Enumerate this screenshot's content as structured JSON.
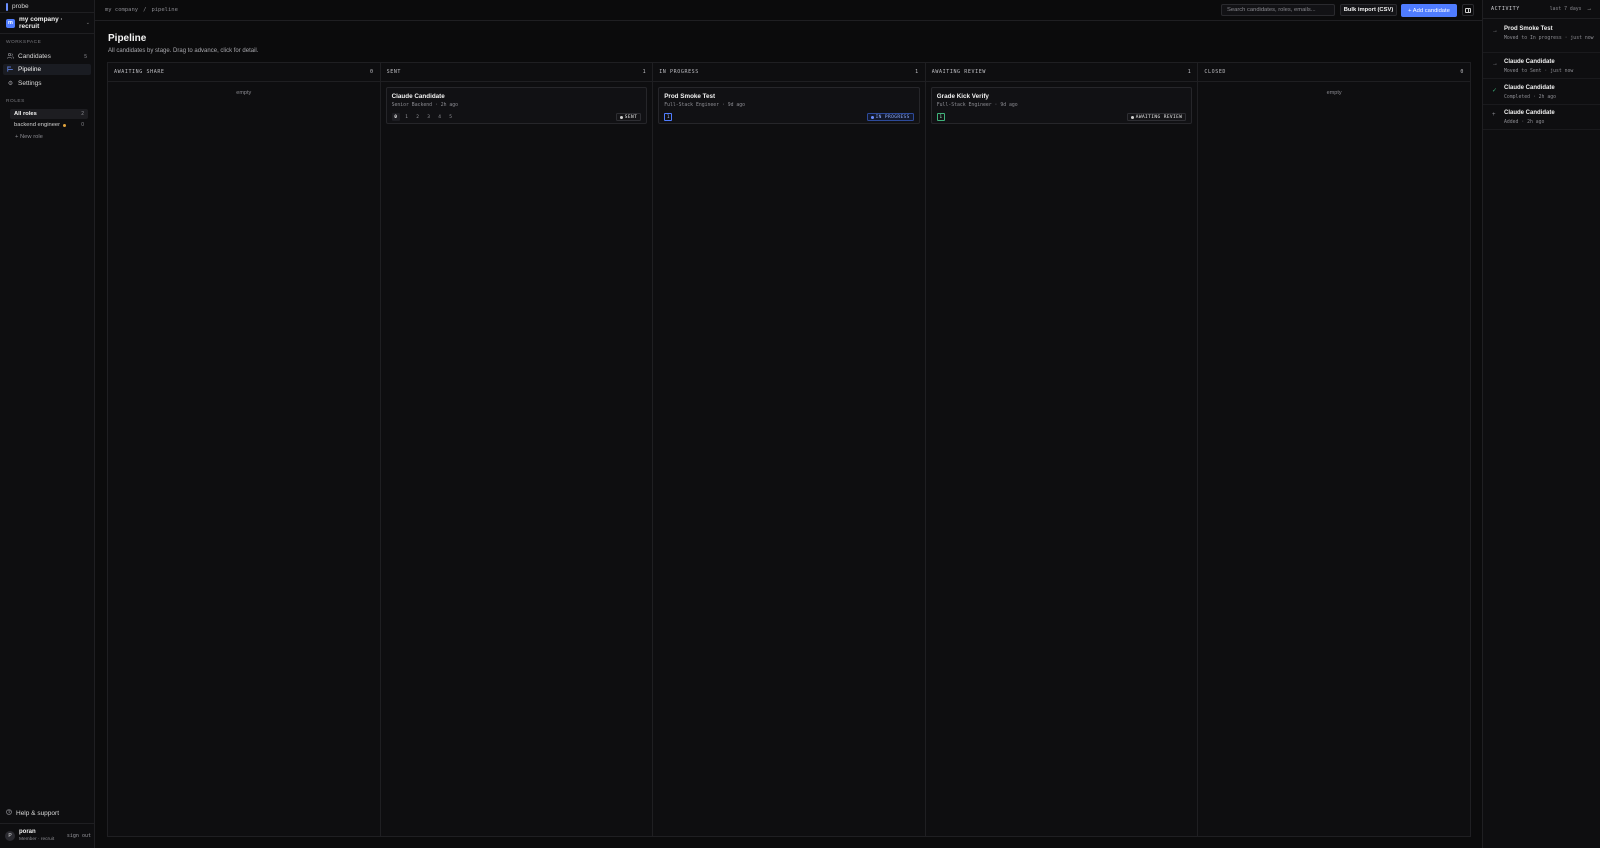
{
  "brand": {
    "name": "probe"
  },
  "workspace": {
    "avatar": "m",
    "name": "my company · recruit"
  },
  "nav": {
    "section_label": "WORKSPACE",
    "items": [
      {
        "label": "Candidates",
        "count": "5",
        "icon": "users-icon"
      },
      {
        "label": "Pipeline",
        "count": "",
        "icon": "pipeline-icon"
      },
      {
        "label": "Settings",
        "count": "",
        "icon": "gear-icon"
      }
    ]
  },
  "roles": {
    "section_label": "ROLES",
    "items": [
      {
        "label": "All roles",
        "count": "2"
      },
      {
        "label": "backend engineer",
        "count": "0"
      }
    ],
    "new_role": "+ New role"
  },
  "help": {
    "label": "Help & support"
  },
  "user": {
    "avatar": "P",
    "name": "poran",
    "role": "Member · recruit",
    "signout": "sign out"
  },
  "topbar": {
    "breadcrumb": [
      "my company",
      "/",
      "pipeline"
    ],
    "search_placeholder": "Search candidates, roles, emails...",
    "bulk_label": "Bulk import (CSV)",
    "add_label": "+ Add candidate"
  },
  "page": {
    "title": "Pipeline",
    "subtitle": "All candidates by stage. Drag to advance, click for detail."
  },
  "columns": [
    {
      "label": "AWAITING SHARE",
      "count": "0",
      "empty": "empty"
    },
    {
      "label": "SENT",
      "count": "1",
      "card": {
        "name": "Claude Candidate",
        "meta": "Senior Backend · 2h ago",
        "steps": [
          "0",
          "1",
          "2",
          "3",
          "4",
          "5"
        ],
        "badge": "SENT"
      }
    },
    {
      "label": "IN PROGRESS",
      "count": "1",
      "card": {
        "name": "Prod Smoke Test",
        "meta": "Full-Stack Engineer · 9d ago",
        "steps": [
          "1"
        ],
        "badge": "IN PROGRESS"
      }
    },
    {
      "label": "AWAITING REVIEW",
      "count": "1",
      "card": {
        "name": "Grade Kick Verify",
        "meta": "Full-Stack Engineer · 9d ago",
        "steps": [
          "1"
        ],
        "badge": "AWAITING REVIEW"
      }
    },
    {
      "label": "CLOSED",
      "count": "0",
      "empty": "empty"
    }
  ],
  "activity": {
    "title": "ACTIVITY",
    "range": "last 7 days",
    "collapse": "→",
    "items": [
      {
        "icon": "arrow-right-icon",
        "glyph": "→",
        "name": "Prod Smoke Test",
        "text": "Moved to In progress · just now"
      },
      {
        "icon": "arrow-right-icon",
        "glyph": "→",
        "name": "Claude Candidate",
        "text": "Moved to Sent · just now"
      },
      {
        "icon": "check-icon",
        "glyph": "✓",
        "name": "Claude Candidate",
        "text": "Completed · 2h ago"
      },
      {
        "icon": "plus-icon",
        "glyph": "+",
        "name": "Claude Candidate",
        "text": "Added · 2h ago"
      }
    ]
  },
  "colors": {
    "accent": "#4f7cff",
    "background": "#0b0b0c",
    "success": "#3fb27a",
    "role_dot": "#e0a33c"
  }
}
